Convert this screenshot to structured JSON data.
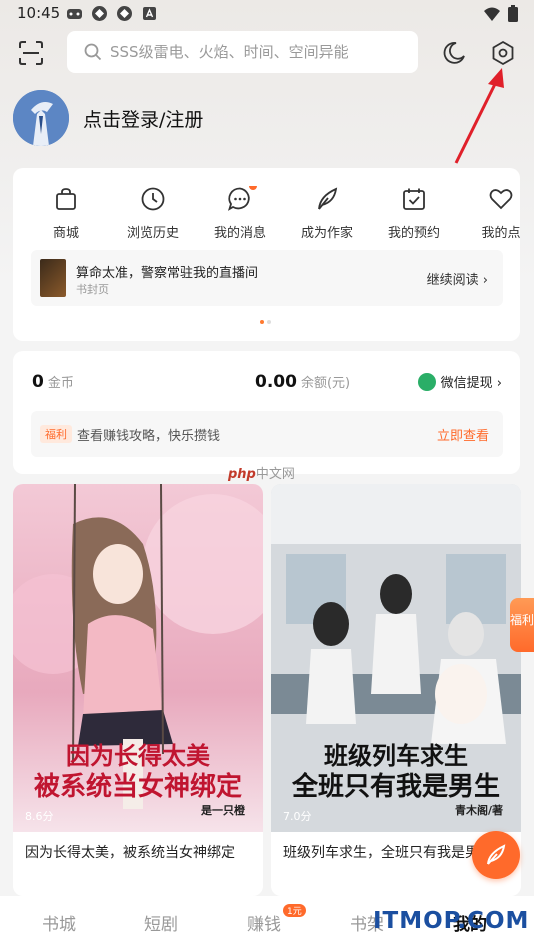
{
  "status": {
    "time": "10:45"
  },
  "search": {
    "placeholder": "SSS级雷电、火焰、时间、空间异能"
  },
  "profile": {
    "login_text": "点击登录/注册"
  },
  "menu": {
    "items": [
      {
        "label": "商城",
        "icon": "bag-icon"
      },
      {
        "label": "浏览历史",
        "icon": "clock-icon"
      },
      {
        "label": "我的消息",
        "icon": "message-icon"
      },
      {
        "label": "成为作家",
        "icon": "quill-icon"
      },
      {
        "label": "我的预约",
        "icon": "calendar-check-icon"
      },
      {
        "label": "我的点",
        "icon": "heart-icon"
      }
    ],
    "continue": {
      "title": "算命太准，警察常驻我的直播间",
      "subtitle": "书封页",
      "action": "继续阅读 ›"
    }
  },
  "wallet": {
    "coins_value": "0",
    "coins_label": "金币",
    "balance_value": "0.00",
    "balance_label": "余额(元)",
    "wechat_label": "微信提现 ›",
    "welfare_tag": "福利",
    "welfare_text": "查看赚钱攻略，快乐攒钱",
    "welfare_action": "立即查看"
  },
  "watermark": {
    "php": "php",
    "cn": "中文网"
  },
  "books": [
    {
      "cover_line1": "因为长得太美",
      "cover_line2": "被系统当女神绑定",
      "author": "是一只橙",
      "score": "8.6分",
      "desc": "因为长得太美，被系统当女神绑定"
    },
    {
      "cover_line1": "班级列车求生",
      "cover_line2": "全班只有我是男生",
      "author": "青木阁/著",
      "score": "7.0分",
      "desc": "班级列车求生，全班只有我是男生"
    }
  ],
  "float": {
    "welfare": "福利"
  },
  "bottom_nav": {
    "items": [
      "书城",
      "短剧",
      "赚钱",
      "书架",
      "我的"
    ],
    "badge": "1元"
  },
  "site_mark": "ITMOP.COM",
  "colors": {
    "accent": "#ff6a2b",
    "wechat": "#2aae67",
    "brand_blue": "#1b4fa0"
  }
}
